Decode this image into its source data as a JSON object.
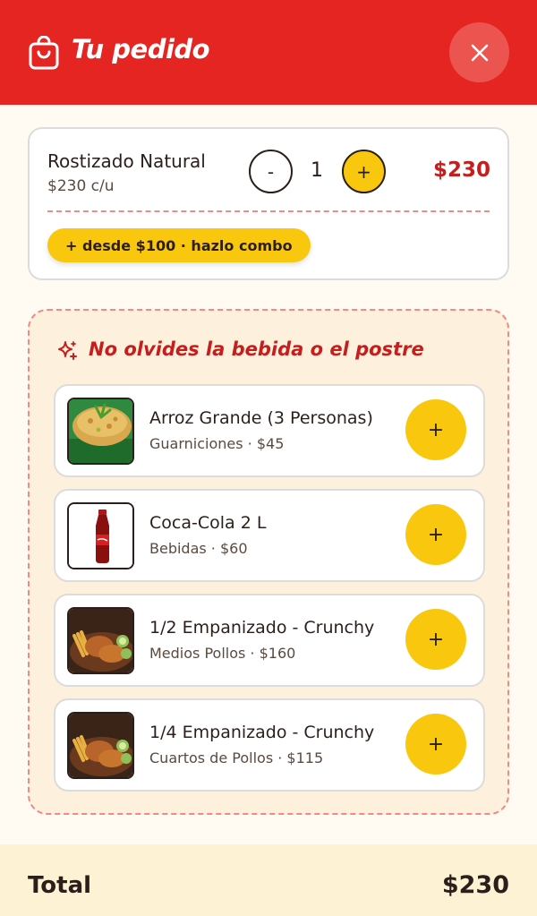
{
  "header": {
    "title": "Tu pedido",
    "icon": "shopping-bag-icon",
    "close_icon": "close-icon"
  },
  "cart": {
    "items": [
      {
        "name": "Rostizado Natural",
        "unit_price": "$230 c/u",
        "minus_label": "-",
        "quantity": "1",
        "plus_label": "+",
        "total": "$230",
        "combo_label": "+ desde $100 · hazlo combo"
      }
    ]
  },
  "upsell": {
    "icon": "sparkle-icon",
    "heading": "No olvides la bebida o el postre",
    "items": [
      {
        "name": "Arroz Grande (3 Personas)",
        "subtitle": "Guarniciones · $45",
        "add_label": "+",
        "image": "rice-dish-image"
      },
      {
        "name": "Coca-Cola 2 L",
        "subtitle": "Bebidas · $60",
        "add_label": "+",
        "image": "coca-cola-bottle-image"
      },
      {
        "name": "1/2 Empanizado - Crunchy",
        "subtitle": "Medios Pollos · $160",
        "add_label": "+",
        "image": "fried-chicken-image"
      },
      {
        "name": "1/4 Empanizado - Crunchy",
        "subtitle": "Cuartos de Pollos · $115",
        "add_label": "+",
        "image": "fried-chicken-image"
      }
    ]
  },
  "footer": {
    "total_label": "Total",
    "total_value": "$230"
  },
  "colors": {
    "brand_red": "#e42521",
    "accent_yellow": "#f9c80e",
    "price_red": "#c61d1d",
    "dashed_border": "#ef8a85",
    "upsell_bg": "#fdf0dd"
  }
}
